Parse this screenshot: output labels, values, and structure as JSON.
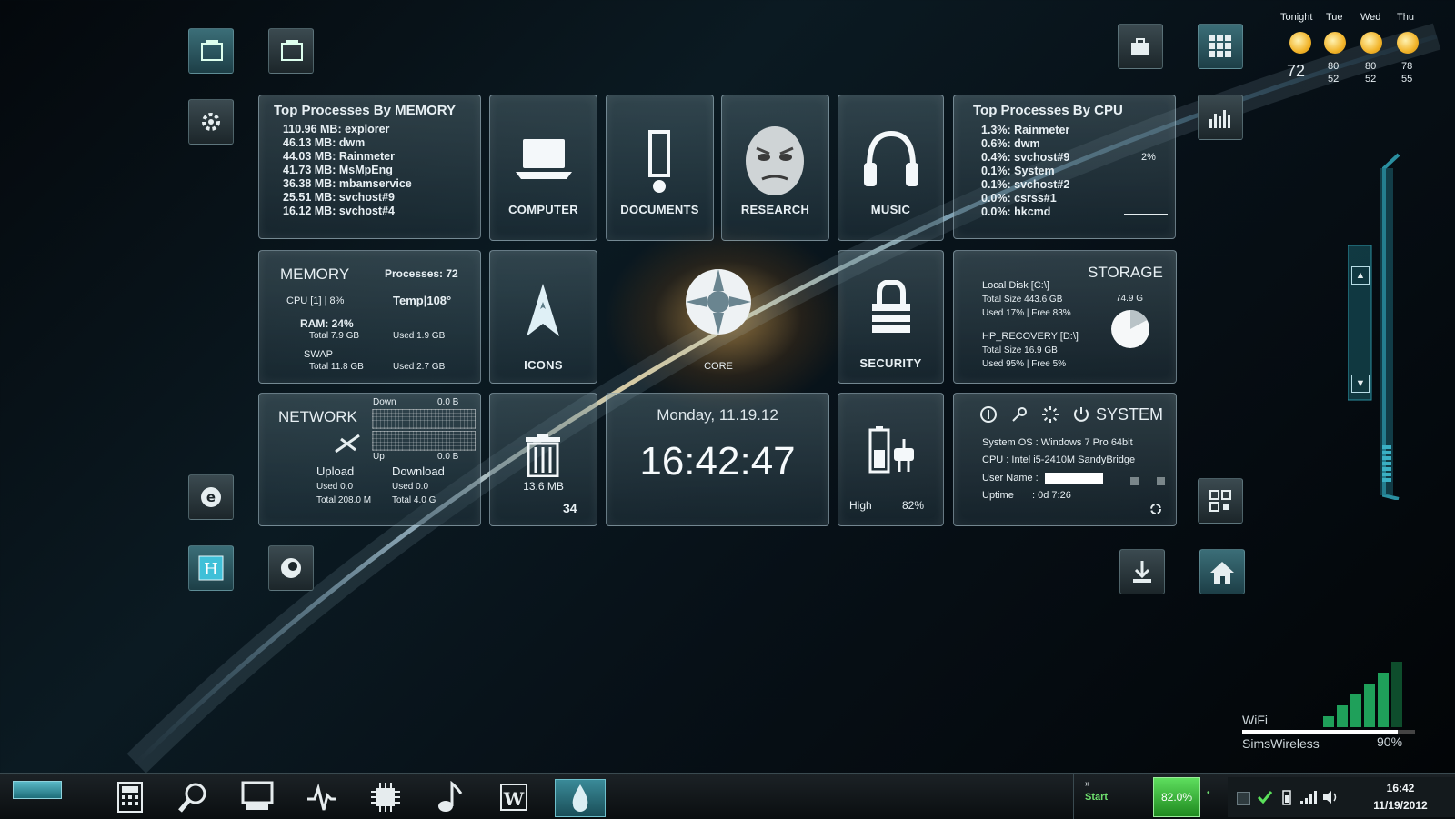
{
  "weather": {
    "days": [
      {
        "label": "Tonight",
        "temp": "72"
      },
      {
        "label": "Tue",
        "high": "80",
        "low": "52"
      },
      {
        "label": "Wed",
        "high": "80",
        "low": "52"
      },
      {
        "label": "Thu",
        "high": "78",
        "low": "55"
      }
    ]
  },
  "mem_procs": {
    "title": "Top Processes By MEMORY",
    "items": [
      "110.96 MB: explorer",
      "46.13 MB: dwm",
      "44.03 MB: Rainmeter",
      "41.73 MB: MsMpEng",
      "36.38 MB: mbamservice",
      "25.51 MB: svchost#9",
      "16.12 MB: svchost#4"
    ]
  },
  "cpu_procs": {
    "title": "Top Processes By CPU",
    "items": [
      "1.3%: Rainmeter",
      "0.6%: dwm",
      "0.4%: svchost#9",
      "0.1%: System",
      "0.1%: svchost#2",
      "0.0%: csrss#1",
      "0.0%: hkcmd"
    ],
    "total": "2%"
  },
  "launch": {
    "computer": "COMPUTER",
    "documents": "DOCUMENTS",
    "research": "RESEARCH",
    "music": "MUSIC",
    "icons": "ICONS",
    "core": "CORE",
    "security": "SECURITY"
  },
  "memory": {
    "title": "MEMORY",
    "processes": "Processes: 72",
    "cpu": "CPU [1] | 8%",
    "temp": "Temp|108°",
    "ram": "RAM: 24%",
    "ram_total": "Total 7.9 GB",
    "ram_used": "Used 1.9 GB",
    "swap": "SWAP",
    "swap_total": "Total 11.8 GB",
    "swap_used": "Used 2.7 GB"
  },
  "storage": {
    "title": "STORAGE",
    "disk1": "Local Disk [C:\\]",
    "disk1_size": "Total Size  443.6 GB",
    "disk1_used": "Used 17%   |   Free 83%",
    "disk1_free": "74.9 G",
    "disk2": "HP_RECOVERY [D:\\]",
    "disk2_size": "Total Size  16.9 GB",
    "disk2_used": "Used 95%   |   Free 5%",
    "pie_used_fraction": 0.17
  },
  "network": {
    "title": "NETWORK",
    "down_label": "Down",
    "down_val": "0.0 B",
    "up_label": "Up",
    "up_val": "0.0 B",
    "upload": "Upload",
    "download": "Download",
    "up_used": "Used   0.0",
    "up_total": "Total   208.0 M",
    "dl_used": "Used   0.0",
    "dl_total": "Total   4.0 G"
  },
  "recycle": {
    "size": "13.6 MB",
    "count": "34"
  },
  "clock": {
    "date": "Monday, 11.19.12",
    "time": "16:42:47"
  },
  "power": {
    "mode": "High",
    "percent": "82%"
  },
  "system": {
    "title": "SYSTEM",
    "os": "System OS : Windows 7 Pro 64bit",
    "cpu": "CPU : Intel i5-2410M SandyBridge",
    "user": "User Name :",
    "uptime_label": "Uptime",
    "uptime": ":    0d 7:26"
  },
  "wifi": {
    "label": "WiFi",
    "ssid": "SimsWireless",
    "strength": "90%",
    "level": 0.9
  },
  "taskbar": {
    "start": "Start",
    "battery": "82.0%",
    "time": "16:42",
    "date": "11/19/2012"
  }
}
